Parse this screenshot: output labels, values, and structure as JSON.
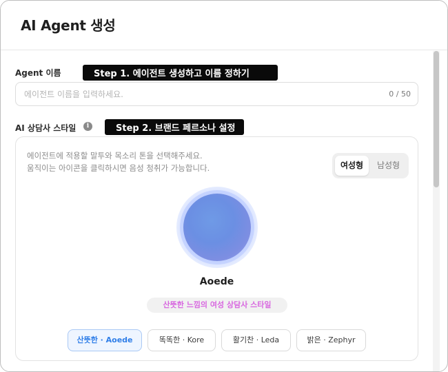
{
  "header": {
    "title": "AI Agent 생성"
  },
  "name_field": {
    "label": "Agent 이름",
    "step_badge": "Step 1. 에이전트 생성하고 이름 정하기",
    "placeholder": "에이전트 이름을 입력하세요.",
    "value": "",
    "char_count": "0 / 50"
  },
  "style_field": {
    "label": "AI 상담사 스타일",
    "info_icon": "info-icon",
    "info_glyph": "i",
    "step_badge": "Step 2. 브랜드 페르소나 설정",
    "description_line1": "에이전트에 적용할 말투와 목소리 톤을 선택해주세요.",
    "description_line2": "움직이는 아이콘을 클릭하시면 음성 청취가 가능합니다.",
    "gender_options": {
      "female": "여성형",
      "male": "남성형",
      "selected": "여성형"
    },
    "selected_voice": {
      "name": "Aoede",
      "tag": "산뜻한 느낌의 여성 상담사 스타일"
    },
    "voices": [
      {
        "label": "산뜻한 · Aoede",
        "selected": true
      },
      {
        "label": "똑똑한 · Kore",
        "selected": false
      },
      {
        "label": "활기찬 · Leda",
        "selected": false
      },
      {
        "label": "밝은 · Zephyr",
        "selected": false
      }
    ]
  },
  "colors": {
    "accent_blue": "#2f7ee8",
    "tag_pink": "#d867e0",
    "orb_blue": "#6b8fe3",
    "step_badge_bg": "#0a0a0a"
  }
}
